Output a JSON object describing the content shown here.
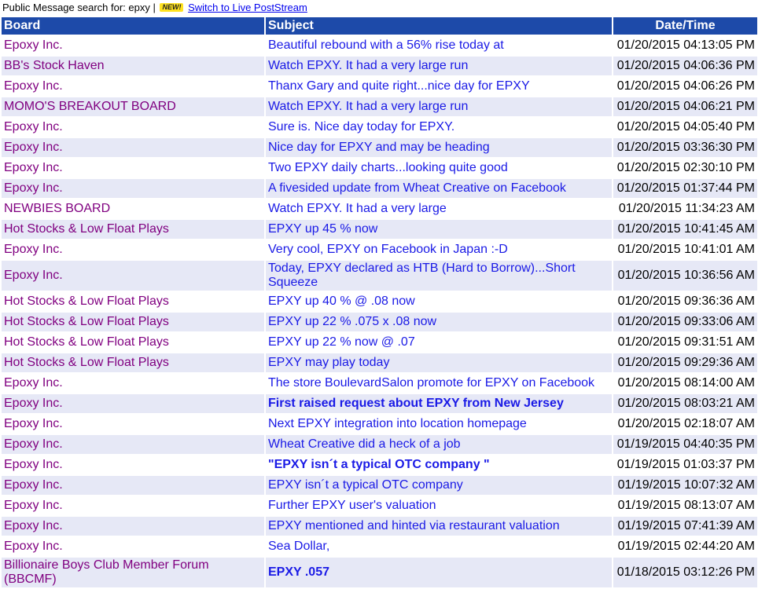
{
  "topbar": {
    "label": "Public Message search for: epxy |",
    "new_badge": "NEW!",
    "live_link": "Switch to Live PostStream"
  },
  "table": {
    "headers": [
      "Board",
      "Subject",
      "Date/Time"
    ],
    "rows": [
      {
        "board": "Epoxy Inc.",
        "subject": "Beautiful rebound with a 56% rise today at",
        "date": "01/20/2015 04:13:05 PM",
        "bold": false
      },
      {
        "board": "BB's Stock Haven",
        "subject": "Watch EPXY. It had a very large run",
        "date": "01/20/2015 04:06:36 PM",
        "bold": false
      },
      {
        "board": "Epoxy Inc.",
        "subject": "Thanx Gary and quite right...nice day for EPXY",
        "date": "01/20/2015 04:06:26 PM",
        "bold": false
      },
      {
        "board": "MOMO'S BREAKOUT BOARD",
        "subject": "Watch EPXY. It had a very large run",
        "date": "01/20/2015 04:06:21 PM",
        "bold": false
      },
      {
        "board": "Epoxy Inc.",
        "subject": "Sure is. Nice day today for EPXY.",
        "date": "01/20/2015 04:05:40 PM",
        "bold": false
      },
      {
        "board": "Epoxy Inc.",
        "subject": "Nice day for EPXY and may be heading",
        "date": "01/20/2015 03:36:30 PM",
        "bold": false
      },
      {
        "board": "Epoxy Inc.",
        "subject": "Two EPXY daily charts...looking quite good",
        "date": "01/20/2015 02:30:10 PM",
        "bold": false
      },
      {
        "board": "Epoxy Inc.",
        "subject": "A fivesided update from Wheat Creative on Facebook",
        "date": "01/20/2015 01:37:44 PM",
        "bold": false
      },
      {
        "board": "NEWBIES BOARD",
        "subject": "Watch EPXY. It had a very large",
        "date": "01/20/2015 11:34:23 AM",
        "bold": false
      },
      {
        "board": "Hot Stocks & Low Float Plays",
        "subject": "EPXY up 45 % now",
        "date": "01/20/2015 10:41:45 AM",
        "bold": false
      },
      {
        "board": "Epoxy Inc.",
        "subject": "Very cool, EPXY on Facebook in Japan :-D",
        "date": "01/20/2015 10:41:01 AM",
        "bold": false
      },
      {
        "board": "Epoxy Inc.",
        "subject": "Today, EPXY declared as HTB (Hard to Borrow)...Short Squeeze",
        "date": "01/20/2015 10:36:56 AM",
        "bold": false
      },
      {
        "board": "Hot Stocks & Low Float Plays",
        "subject": "EPXY up 40 % @ .08 now",
        "date": "01/20/2015 09:36:36 AM",
        "bold": false
      },
      {
        "board": "Hot Stocks & Low Float Plays",
        "subject": "EPXY up 22 % .075 x .08 now",
        "date": "01/20/2015 09:33:06 AM",
        "bold": false
      },
      {
        "board": "Hot Stocks & Low Float Plays",
        "subject": "EPXY up 22 % now @ .07",
        "date": "01/20/2015 09:31:51 AM",
        "bold": false
      },
      {
        "board": "Hot Stocks & Low Float Plays",
        "subject": "EPXY may play today",
        "date": "01/20/2015 09:29:36 AM",
        "bold": false
      },
      {
        "board": "Epoxy Inc.",
        "subject": "The store BoulevardSalon promote for EPXY on Facebook",
        "date": "01/20/2015 08:14:00 AM",
        "bold": false
      },
      {
        "board": "Epoxy Inc.",
        "subject": "First raised request about EPXY from New Jersey",
        "date": "01/20/2015 08:03:21 AM",
        "bold": true
      },
      {
        "board": "Epoxy Inc.",
        "subject": "Next EPXY integration into location homepage",
        "date": "01/20/2015 02:18:07 AM",
        "bold": false
      },
      {
        "board": "Epoxy Inc.",
        "subject": "Wheat Creative did a heck of a job",
        "date": "01/19/2015 04:40:35 PM",
        "bold": false
      },
      {
        "board": "Epoxy Inc.",
        "subject": "\"EPXY isn´t a typical OTC company \"",
        "date": "01/19/2015 01:03:37 PM",
        "bold": true
      },
      {
        "board": "Epoxy Inc.",
        "subject": "EPXY isn´t a typical OTC company",
        "date": "01/19/2015 10:07:32 AM",
        "bold": false
      },
      {
        "board": "Epoxy Inc.",
        "subject": "Further EPXY user's valuation",
        "date": "01/19/2015 08:13:07 AM",
        "bold": false
      },
      {
        "board": "Epoxy Inc.",
        "subject": "EPXY mentioned and hinted via restaurant valuation",
        "date": "01/19/2015 07:41:39 AM",
        "bold": false
      },
      {
        "board": "Epoxy Inc.",
        "subject": "Sea Dollar,",
        "date": "01/19/2015 02:44:20 AM",
        "bold": false
      },
      {
        "board": "Billionaire Boys Club Member Forum (BBCMF)",
        "subject": "EPXY .057",
        "date": "01/18/2015 03:12:26 PM",
        "bold": true
      }
    ]
  },
  "colors": {
    "header_bg": "#1d4aa9",
    "row_alt_bg": "#e6e8f6",
    "board_link": "#800080",
    "subject_link": "#1a1ae6"
  }
}
